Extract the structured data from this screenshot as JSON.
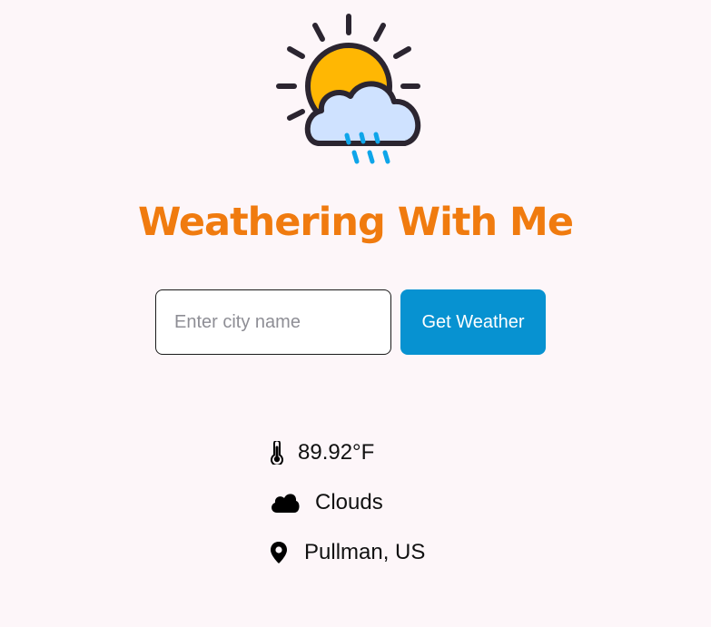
{
  "app": {
    "title": "Weathering With Me",
    "logo_icon": "sun-behind-rain-cloud-icon"
  },
  "search": {
    "placeholder": "Enter city name",
    "value": "",
    "button_label": "Get Weather"
  },
  "weather": {
    "temperature": "89.92°F",
    "temperature_icon": "thermometer-icon",
    "condition": "Clouds",
    "condition_icon": "cloud-icon",
    "location": "Pullman, US",
    "location_icon": "map-pin-icon"
  },
  "colors": {
    "background": "#fdf6f9",
    "title": "#f07b0f",
    "button": "#0792d1",
    "sun": "#ffb703",
    "cloud": "#cfe2ff",
    "rain": "#0ea5e9"
  }
}
